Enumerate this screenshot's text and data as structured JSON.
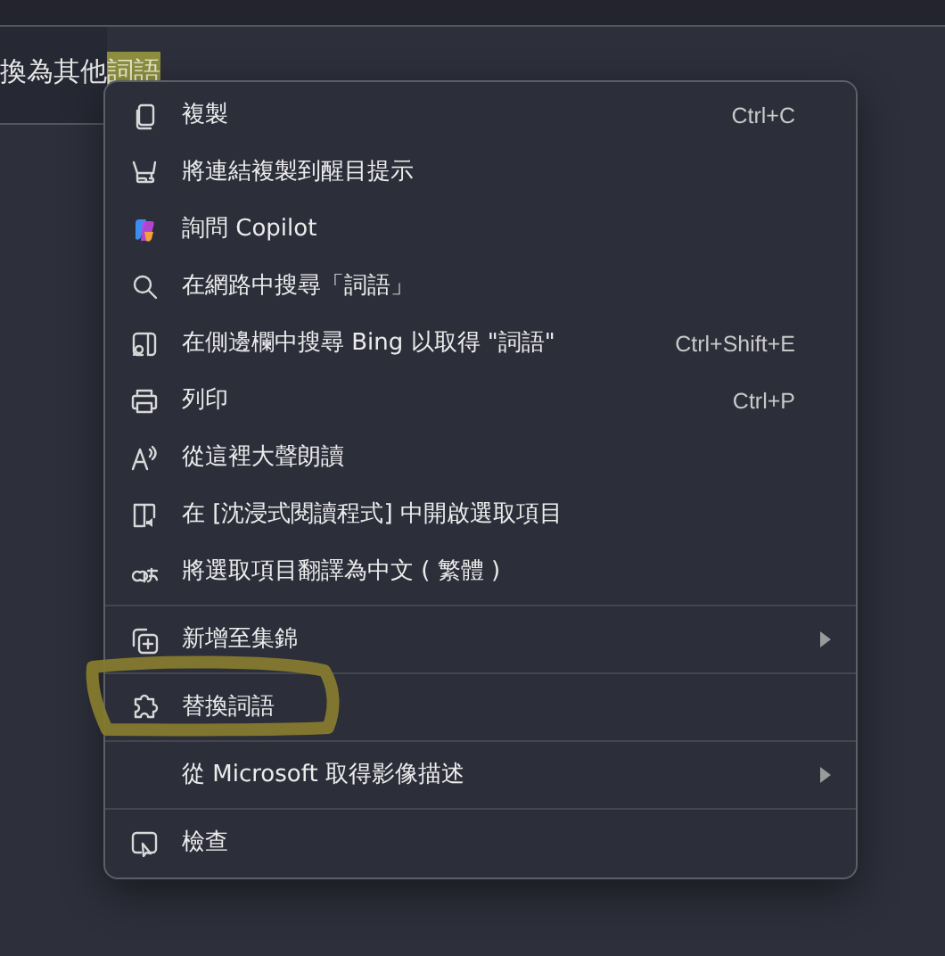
{
  "page_text": {
    "before": "換為其他",
    "selected_text": "詞語",
    "selected": true
  },
  "context_menu": {
    "items": [
      {
        "kind": "item",
        "label": "複製",
        "shortcut": "Ctrl+C",
        "submenu": false
      },
      {
        "kind": "item",
        "label": "將連結複製到醒目提示",
        "submenu": false
      },
      {
        "kind": "item",
        "label": "詢問 Copilot",
        "submenu": false
      },
      {
        "kind": "item",
        "label": "在網路中搜尋「詞語」",
        "submenu": false
      },
      {
        "kind": "item",
        "label": "在側邊欄中搜尋 Bing 以取得 \"詞語\"",
        "shortcut": "Ctrl+Shift+E",
        "submenu": false
      },
      {
        "kind": "item",
        "label": "列印",
        "shortcut": "Ctrl+P",
        "submenu": false
      },
      {
        "kind": "item",
        "label": "從這裡大聲朗讀",
        "submenu": false
      },
      {
        "kind": "item",
        "label": "在 [沈浸式閱讀程式] 中開啟選取項目",
        "submenu": false
      },
      {
        "kind": "item",
        "label": "將選取項目翻譯為中文 ( 繁體 )",
        "submenu": false
      },
      {
        "kind": "separator"
      },
      {
        "kind": "item",
        "label": "新增至集錦",
        "submenu": true
      },
      {
        "kind": "separator"
      },
      {
        "kind": "item",
        "label": "替換詞語",
        "submenu": false
      },
      {
        "kind": "separator"
      },
      {
        "kind": "item",
        "label": "從 Microsoft 取得影像描述",
        "submenu": true
      },
      {
        "kind": "separator"
      },
      {
        "kind": "item",
        "label": "檢查",
        "submenu": false
      }
    ]
  }
}
